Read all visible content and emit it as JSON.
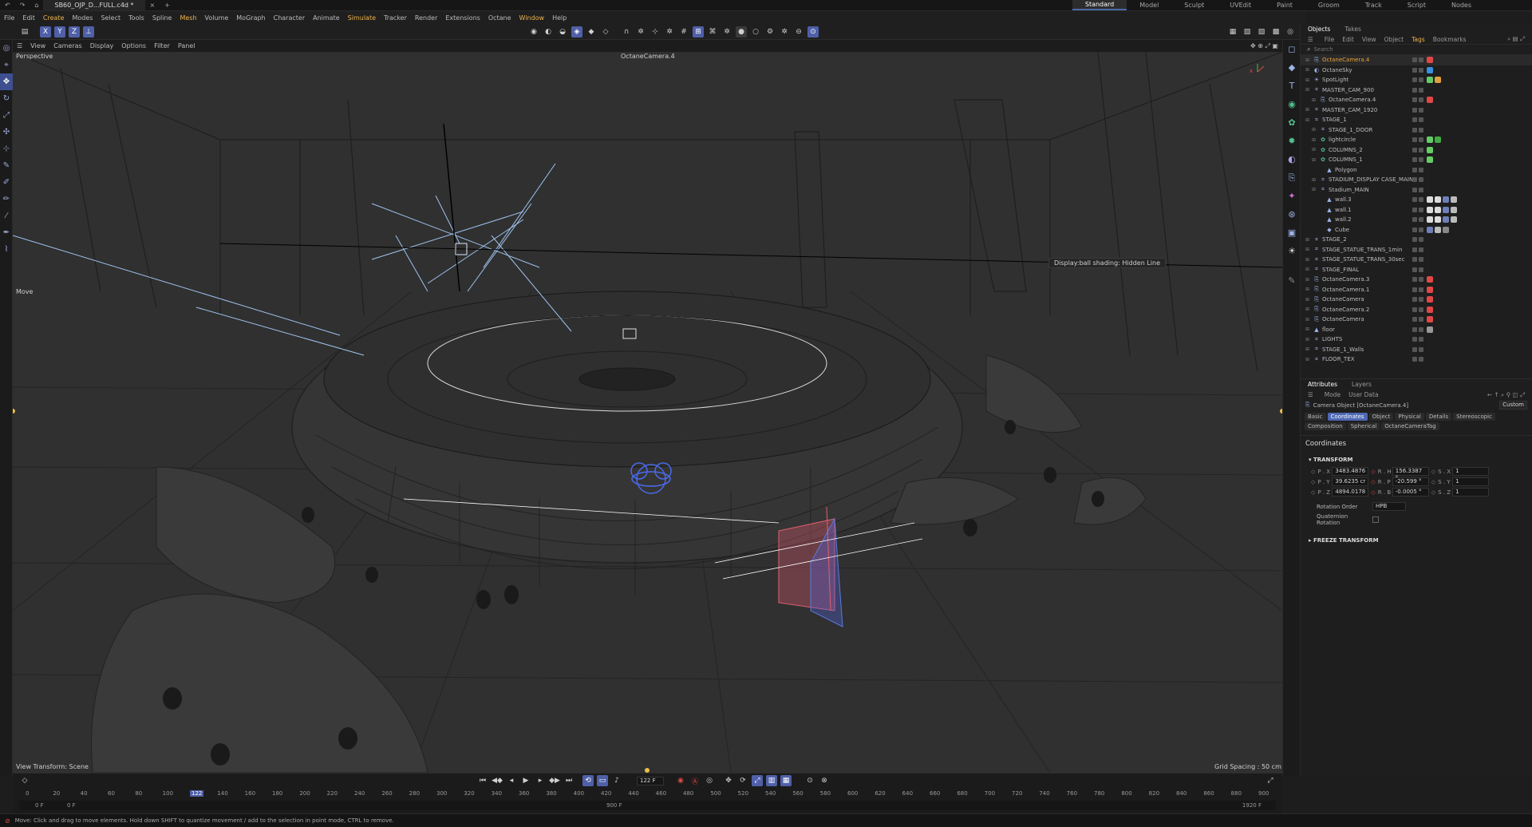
{
  "titlebar": {
    "file_tab": "SB60_OJP_D...FULL.c4d *",
    "workspaces": [
      "Standard",
      "Model",
      "Sculpt",
      "UVEdit",
      "Paint",
      "Groom",
      "Track",
      "Script",
      "Nodes"
    ],
    "active_workspace": "Standard"
  },
  "menu": [
    "File",
    "Edit",
    "Create",
    "Modes",
    "Select",
    "Tools",
    "Spline",
    "Mesh",
    "Volume",
    "MoGraph",
    "Character",
    "Animate",
    "Simulate",
    "Tracker",
    "Render",
    "Extensions",
    "Octane",
    "Window",
    "Help"
  ],
  "menu_highlight": [
    "Create",
    "Mesh",
    "Simulate",
    "Window"
  ],
  "toolbar": {
    "axes": [
      "X",
      "Y",
      "Z"
    ]
  },
  "viewport_menu": [
    "View",
    "Cameras",
    "Display",
    "Options",
    "Filter",
    "Panel"
  ],
  "viewport": {
    "name": "Perspective",
    "camera": "OctaneCamera.4",
    "tool_label": "Move",
    "tooltip": "Display:ball shading: Hidden Line",
    "view_transform": "View Transform: Scene",
    "grid_spacing": "Grid Spacing : 50 cm"
  },
  "objects_panel": {
    "tabs": [
      "Objects",
      "Takes"
    ],
    "menu": [
      "File",
      "Edit",
      "View",
      "Object",
      "Tags",
      "Bookmarks"
    ],
    "search_placeholder": "Search",
    "items": [
      {
        "name": "OctaneCamera.4",
        "depth": 0,
        "icon": "camera-icon",
        "color": "#e8a23a",
        "tags": [
          "#e04848"
        ]
      },
      {
        "name": "OctaneSky",
        "depth": 0,
        "icon": "sky-icon",
        "color": "#bdbdbd",
        "tags": [
          "#3a8fe0"
        ]
      },
      {
        "name": "SpotLight",
        "depth": 0,
        "icon": "light-icon",
        "color": "#bdbdbd",
        "tags": [
          "#66cc66",
          "#e0a040"
        ]
      },
      {
        "name": "MASTER_CAM_900",
        "depth": 0,
        "icon": "null-icon",
        "color": "#bdbdbd",
        "tags": []
      },
      {
        "name": "OctaneCamera.4",
        "depth": 1,
        "icon": "camera-icon",
        "color": "#bdbdbd",
        "tags": [
          "#e04848"
        ]
      },
      {
        "name": "MASTER_CAM_1920",
        "depth": 0,
        "icon": "null-icon",
        "color": "#bdbdbd",
        "tags": []
      },
      {
        "name": "STAGE_1",
        "depth": 0,
        "icon": "null-icon",
        "color": "#bdbdbd",
        "tags": []
      },
      {
        "name": "STAGE_1_DOOR",
        "depth": 1,
        "icon": "null-icon",
        "color": "#bdbdbd",
        "tags": []
      },
      {
        "name": "lightcircle",
        "depth": 1,
        "icon": "cloner-icon",
        "color": "#bdbdbd",
        "tags": [
          "#66cc66",
          "#44aa44"
        ]
      },
      {
        "name": "COLUMNS_2",
        "depth": 1,
        "icon": "cloner-icon",
        "color": "#bdbdbd",
        "tags": [
          "#66cc66"
        ]
      },
      {
        "name": "COLUMNS_1",
        "depth": 1,
        "icon": "cloner-icon",
        "color": "#bdbdbd",
        "tags": [
          "#66cc66"
        ]
      },
      {
        "name": "Polygon",
        "depth": 2,
        "icon": "polygon-icon",
        "color": "#bdbdbd",
        "tags": []
      },
      {
        "name": "STADIUM_DISPLAY CASE_MAIN",
        "depth": 1,
        "icon": "null-icon",
        "color": "#bdbdbd",
        "tags": []
      },
      {
        "name": "Stadium_MAIN",
        "depth": 1,
        "icon": "null-icon",
        "color": "#bdbdbd",
        "tags": []
      },
      {
        "name": "wall.3",
        "depth": 2,
        "icon": "polygon-icon",
        "color": "#bdbdbd",
        "tags": [
          "#dddddd",
          "#dddddd",
          "#6f7fb8",
          "#bbbbbb"
        ]
      },
      {
        "name": "wall.1",
        "depth": 2,
        "icon": "polygon-icon",
        "color": "#bdbdbd",
        "tags": [
          "#dddddd",
          "#dddddd",
          "#6f7fb8",
          "#bbbbbb"
        ]
      },
      {
        "name": "wall.2",
        "depth": 2,
        "icon": "polygon-icon",
        "color": "#bdbdbd",
        "tags": [
          "#dddddd",
          "#dddddd",
          "#6f7fb8",
          "#bbbbbb"
        ]
      },
      {
        "name": "Cube",
        "depth": 2,
        "icon": "cube-icon",
        "color": "#bdbdbd",
        "tags": [
          "#6f7fb8",
          "#bbbbbb",
          "#888888"
        ]
      },
      {
        "name": "STAGE_2",
        "depth": 0,
        "icon": "null-icon",
        "color": "#bdbdbd",
        "tags": []
      },
      {
        "name": "STAGE_STATUE_TRANS_1min",
        "depth": 0,
        "icon": "null-icon",
        "color": "#bdbdbd",
        "tags": []
      },
      {
        "name": "STAGE_STATUE_TRANS_30sec",
        "depth": 0,
        "icon": "null-icon",
        "color": "#bdbdbd",
        "tags": []
      },
      {
        "name": "STAGE_FINAL",
        "depth": 0,
        "icon": "null-icon",
        "color": "#bdbdbd",
        "tags": []
      },
      {
        "name": "OctaneCamera.3",
        "depth": 0,
        "icon": "camera-icon",
        "color": "#bdbdbd",
        "tags": [
          "#e04848"
        ]
      },
      {
        "name": "OctaneCamera.1",
        "depth": 0,
        "icon": "camera-icon",
        "color": "#bdbdbd",
        "tags": [
          "#e04848"
        ]
      },
      {
        "name": "OctaneCamera",
        "depth": 0,
        "icon": "camera-icon",
        "color": "#bdbdbd",
        "tags": [
          "#e04848"
        ]
      },
      {
        "name": "OctaneCamera.2",
        "depth": 0,
        "icon": "camera-icon",
        "color": "#bdbdbd",
        "tags": [
          "#e04848"
        ]
      },
      {
        "name": "OctaneCamera",
        "depth": 0,
        "icon": "camera-icon",
        "color": "#bdbdbd",
        "tags": [
          "#e04848"
        ]
      },
      {
        "name": "floor",
        "depth": 0,
        "icon": "polygon-icon",
        "color": "#bdbdbd",
        "tags": [
          "#999999"
        ]
      },
      {
        "name": "LIGHTS",
        "depth": 0,
        "icon": "null-icon",
        "color": "#bdbdbd",
        "tags": []
      },
      {
        "name": "STAGE_1_Walls",
        "depth": 0,
        "icon": "null-icon",
        "color": "#bdbdbd",
        "tags": []
      },
      {
        "name": "FLOOR_TEX",
        "depth": 0,
        "icon": "null-icon",
        "color": "#bdbdbd",
        "tags": []
      }
    ]
  },
  "attributes": {
    "tabs": [
      "Attributes",
      "Layers"
    ],
    "menu": [
      "Mode",
      "User Data"
    ],
    "object_title": "Camera Object [OctaneCamera.4]",
    "preset": "Custom",
    "subtabs": [
      "Basic",
      "Coordinates",
      "Object",
      "Physical",
      "Details",
      "Stereoscopic",
      "Composition",
      "Spherical",
      "OctaneCameraTag"
    ],
    "active_subtab": "Coordinates",
    "section": "Coordinates",
    "group": "TRANSFORM",
    "transform": [
      {
        "p_label": "P . X",
        "p_val": "3483.4876",
        "r_label": "R . H",
        "r_val": "156.3387 °",
        "s_label": "S . X",
        "s_val": "1"
      },
      {
        "p_label": "P . Y",
        "p_val": "39.6235 cr",
        "r_label": "R . P",
        "r_val": "-20.599 °",
        "s_label": "S . Y",
        "s_val": "1"
      },
      {
        "p_label": "P . Z",
        "p_val": "4894.0178",
        "r_label": "R . B",
        "r_val": "-0.0005 °",
        "s_label": "S . Z",
        "s_val": "1"
      }
    ],
    "rotation_order_label": "Rotation Order",
    "rotation_order": "HPB",
    "quaternion_label": "Quaternion Rotation",
    "freeze": "FREEZE TRANSFORM"
  },
  "timeline": {
    "current_frame": "122 F",
    "ticks": [
      "0",
      "20",
      "40",
      "60",
      "80",
      "100",
      "122",
      "140",
      "160",
      "180",
      "200",
      "220",
      "240",
      "260",
      "280",
      "300",
      "320",
      "340",
      "360",
      "380",
      "400",
      "420",
      "440",
      "460",
      "480",
      "500",
      "520",
      "540",
      "560",
      "580",
      "600",
      "620",
      "640",
      "660",
      "680",
      "700",
      "720",
      "740",
      "760",
      "780",
      "800",
      "820",
      "840",
      "860",
      "880",
      "900"
    ],
    "start": "0 F",
    "start2": "0 F",
    "end_mid": "900 F",
    "end": "1920 F"
  },
  "status": "Move: Click and drag to move elements. Hold down SHIFT to quantize movement / add to the selection in point mode, CTRL to remove.",
  "colors": {
    "accent": "#4f5fa8",
    "highlight_menu": "#f0b44c",
    "camera_item": "#e8a23a"
  }
}
